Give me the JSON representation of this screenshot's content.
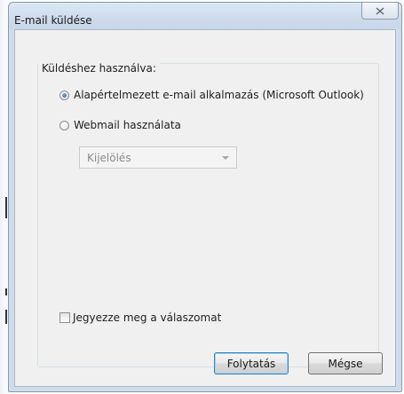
{
  "dialog": {
    "title": "E-mail küldése",
    "close_icon": "close-icon"
  },
  "group": {
    "legend": "Küldéshez használva:",
    "options": [
      {
        "label": "Alapértelmezett e-mail alkalmazás (Microsoft Outlook)",
        "checked": true
      },
      {
        "label": "Webmail használata",
        "checked": false
      }
    ],
    "webmail_select": {
      "value": "Kijelölés",
      "enabled": false
    }
  },
  "remember": {
    "label": "Jegyezze meg a válaszomat",
    "checked": false
  },
  "buttons": {
    "continue": "Folytatás",
    "cancel": "Mégse"
  }
}
